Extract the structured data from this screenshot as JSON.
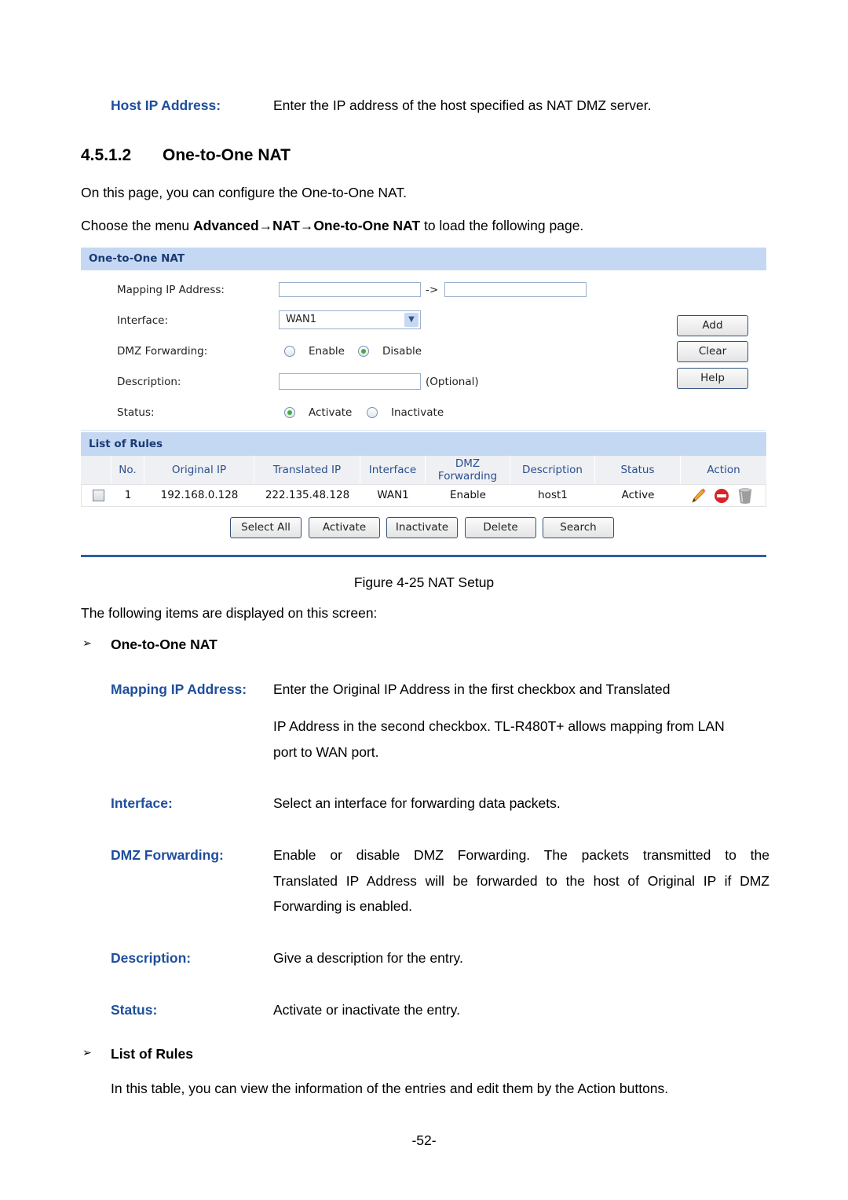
{
  "intro": {
    "host_ip_label": "Host IP Address:",
    "host_ip_desc": "Enter the IP address of the host specified as NAT DMZ server."
  },
  "section": {
    "number": "4.5.1.2",
    "title": "One-to-One NAT",
    "para1": "On this page, you can configure the One-to-One NAT.",
    "para2_prefix": "Choose the menu ",
    "para2_menu": "Advanced→NAT→One-to-One NAT",
    "para2_suffix": " to load the following page."
  },
  "panel": {
    "header": "One-to-One NAT",
    "form": {
      "mapping_label": "Mapping IP Address:",
      "mapping_original_value": "",
      "arrow": "->",
      "mapping_translated_value": "",
      "interface_label": "Interface:",
      "interface_value": "WAN1",
      "dmz_label": "DMZ Forwarding:",
      "dmz_options": [
        "Enable",
        "Disable"
      ],
      "dmz_selected": "Disable",
      "description_label": "Description:",
      "description_value": "",
      "description_hint": "(Optional)",
      "status_label": "Status:",
      "status_options": [
        "Activate",
        "Inactivate"
      ],
      "status_selected": "Activate"
    },
    "side_buttons": [
      "Add",
      "Clear",
      "Help"
    ],
    "rules_header": "List of Rules",
    "table": {
      "columns": [
        "",
        "No.",
        "Original IP",
        "Translated IP",
        "Interface",
        "DMZ Forwarding",
        "Description",
        "Status",
        "Action"
      ],
      "dmz_col_line1": "DMZ",
      "dmz_col_line2": "Forwarding",
      "rows": [
        {
          "checked": false,
          "no": "1",
          "original_ip": "192.168.0.128",
          "translated_ip": "222.135.48.128",
          "interface": "WAN1",
          "dmz": "Enable",
          "description": "host1",
          "status": "Active",
          "actions": [
            "edit-icon",
            "disable-icon",
            "delete-icon"
          ]
        }
      ]
    },
    "bottom_buttons": [
      "Select All",
      "Activate",
      "Inactivate",
      "Delete",
      "Search"
    ]
  },
  "figure_caption": "Figure 4-25 NAT Setup",
  "items_intro": "The following items are displayed on this screen:",
  "bullet1": "One-to-One NAT",
  "fields": [
    {
      "label": "Mapping IP Address:",
      "desc1": "Enter the Original IP Address in the first checkbox and Translated",
      "desc2": "IP Address in the second checkbox. TL-R480T+ allows mapping from LAN",
      "desc3": "port to WAN port."
    },
    {
      "label": "Interface:",
      "desc1": "Select an interface for forwarding data packets."
    },
    {
      "label": "DMZ Forwarding:",
      "desc1": "Enable or disable DMZ Forwarding. The packets transmitted to the",
      "desc2": "Translated IP Address will be forwarded to the host of Original IP if DMZ",
      "desc3": "Forwarding is enabled."
    },
    {
      "label": "Description:",
      "desc1": "Give a description for the entry."
    },
    {
      "label": "Status:",
      "desc1": "Activate or inactivate the entry."
    }
  ],
  "bullet2": "List of Rules",
  "rules_desc": "In this table, you can view the information of the entries and edit them by the Action buttons.",
  "bullet_symbol": "➢",
  "page_number": "-52-"
}
